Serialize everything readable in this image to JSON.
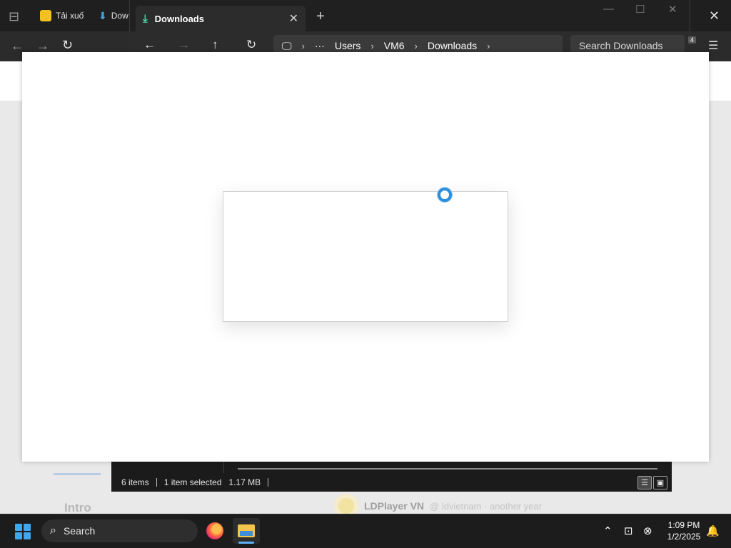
{
  "browser": {
    "tabs": [
      {
        "label": "Tải xuố",
        "icon": "ldplayer-favicon"
      },
      {
        "label": "Dow",
        "icon": "download-favicon"
      }
    ],
    "page": {
      "intro_label": "Intro",
      "channel_name": "LDPlayer VN",
      "channel_sub": "@ ldvietnam · another year"
    }
  },
  "explorer": {
    "tab_title": "Downloads",
    "breadcrumb": [
      "Users",
      "VM6",
      "Downloads"
    ],
    "search_placeholder": "Search Downloads",
    "badge": "4",
    "status": {
      "items": "6 items",
      "selected": "1 item selected",
      "size": "1.17 MB"
    }
  },
  "taskbar": {
    "search_label": "Search",
    "time": "1:09 PM",
    "date": "1/2/2025",
    "accent": "#3ea7f0"
  }
}
